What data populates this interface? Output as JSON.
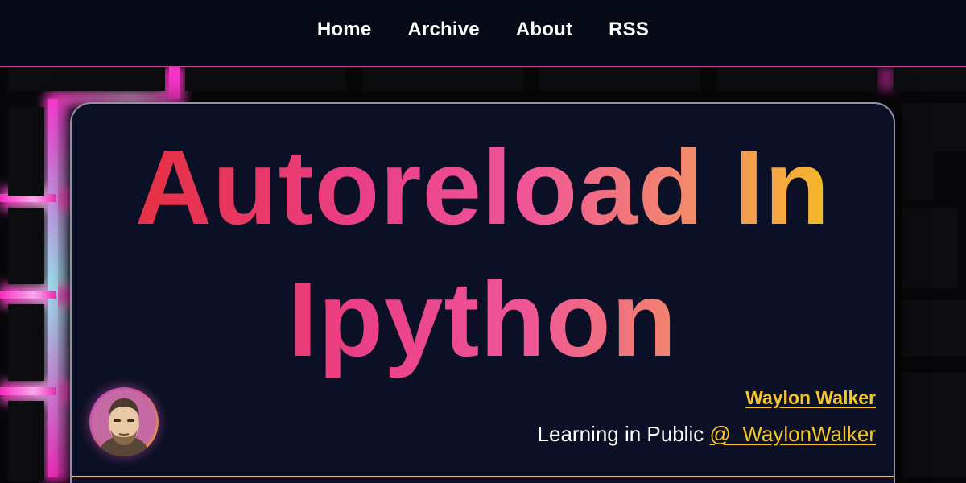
{
  "nav": {
    "items": [
      {
        "label": "Home"
      },
      {
        "label": "Archive"
      },
      {
        "label": "About"
      },
      {
        "label": "RSS"
      }
    ]
  },
  "post": {
    "title": "Autoreload In Ipython"
  },
  "author": {
    "name": "Waylon Walker",
    "tagline": "Learning in Public",
    "handle": "@_WaylonWalker"
  },
  "colors": {
    "accent_gold": "#f7c626",
    "nav_border": "#c2418f",
    "card_bg": "#0b1026",
    "title_gradient": [
      "#e63146",
      "#ea3f87",
      "#ef5598",
      "#f3896a",
      "#f7b829"
    ]
  },
  "icons": {
    "avatar": "author-avatar-illustration"
  }
}
